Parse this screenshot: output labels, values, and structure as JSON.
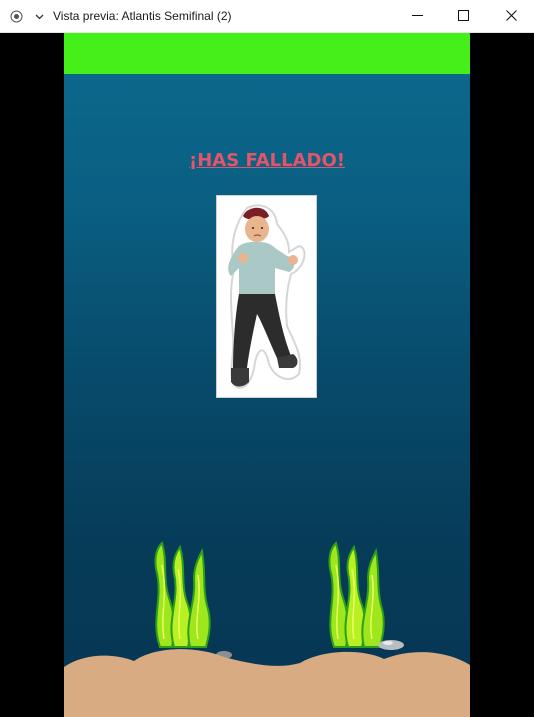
{
  "window": {
    "title": "Vista previa: Atlantis Semifinal (2)",
    "icons": {
      "app": "radio-dot-icon",
      "menu": "chevron-down-icon",
      "minimize": "minimize-icon",
      "maximize": "maximize-icon",
      "close": "close-icon"
    }
  },
  "game": {
    "top_bar_color": "#45ef1a",
    "message": "¡HAS FALLADO!",
    "message_color": "#e4546a",
    "image": "kid-fighting-pose-sticker",
    "sand_color": "#d8ab82",
    "seaweed_color": "#9fe61c"
  }
}
